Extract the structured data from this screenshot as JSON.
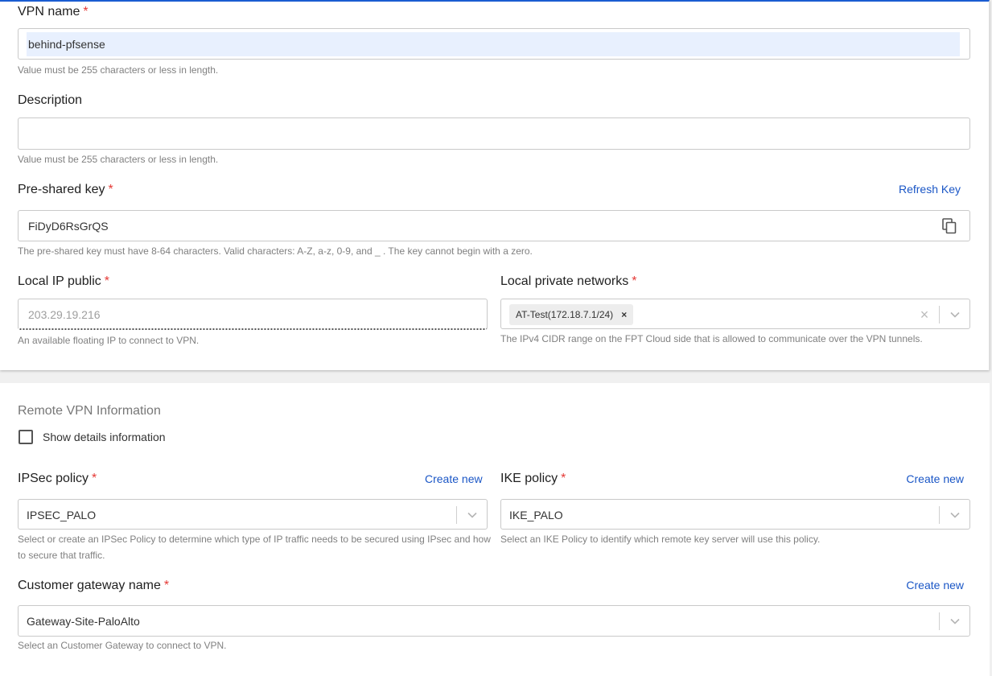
{
  "vpn_name": {
    "label": "VPN name",
    "required_mark": "*",
    "value": "behind-pfsense",
    "helper": "Value must be 255 characters or less in length."
  },
  "description": {
    "label": "Description",
    "value": "",
    "helper": "Value must be 255 characters or less in length."
  },
  "pre_shared_key": {
    "label": "Pre-shared key",
    "required_mark": "*",
    "refresh_label": "Refresh Key",
    "value": "FiDyD6RsGrQS",
    "helper": "The pre-shared key must have 8-64 characters. Valid characters: A-Z, a-z, 0-9, and _ . The key cannot begin with a zero."
  },
  "local_ip_public": {
    "label": "Local IP public",
    "required_mark": "*",
    "value": "203.29.19.216",
    "helper": "An available floating IP to connect to VPN."
  },
  "local_private_networks": {
    "label": "Local private networks",
    "required_mark": "*",
    "chips": [
      "AT-Test(172.18.7.1/24)"
    ],
    "chip_remove": "×",
    "clear_glyph": "×",
    "helper": "The IPv4 CIDR range on the FPT Cloud side that is allowed to communicate over the VPN tunnels."
  },
  "remote": {
    "section_title": "Remote VPN Information",
    "show_details_label": "Show details information",
    "show_details_checked": false
  },
  "ipsec_policy": {
    "label": "IPSec policy",
    "required_mark": "*",
    "create_label": "Create new",
    "value": "IPSEC_PALO",
    "helper": "Select or create an IPSec Policy to determine which type of IP traffic needs to be secured using IPsec and how to secure that traffic."
  },
  "ike_policy": {
    "label": "IKE policy",
    "required_mark": "*",
    "create_label": "Create new",
    "value": "IKE_PALO",
    "helper": "Select an IKE Policy to identify which remote key server will use this policy."
  },
  "customer_gateway": {
    "label": "Customer gateway name",
    "required_mark": "*",
    "create_label": "Create new",
    "value": "Gateway-Site-PaloAlto",
    "helper": "Select an Customer Gateway to connect to VPN."
  },
  "icons": {
    "copy": "copy-icon",
    "chevron": "chevron-down-icon",
    "clear": "close-icon"
  },
  "colors": {
    "accent": "#1a56c6",
    "required": "#e53935",
    "selection": "#e8f0fe"
  }
}
